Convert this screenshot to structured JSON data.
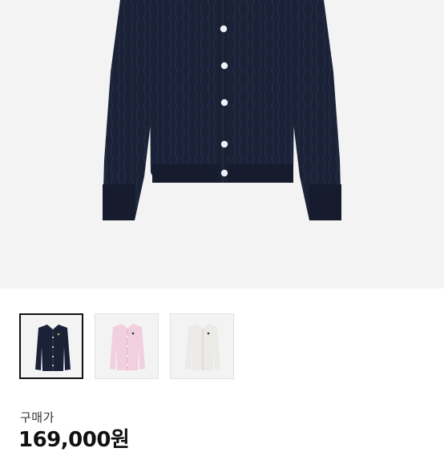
{
  "product": {
    "images": [
      {
        "name": "navy",
        "color": "#1b2237",
        "selected": true
      },
      {
        "name": "pink",
        "color": "#f1cfdc",
        "selected": false
      },
      {
        "name": "white",
        "color": "#ebeae6",
        "selected": false
      }
    ],
    "price_label": "구매가",
    "price": "169,000원"
  },
  "colors": {
    "hero_background": "#f3f3f3",
    "button": "#eef0f5",
    "selected_border": "#111111"
  }
}
